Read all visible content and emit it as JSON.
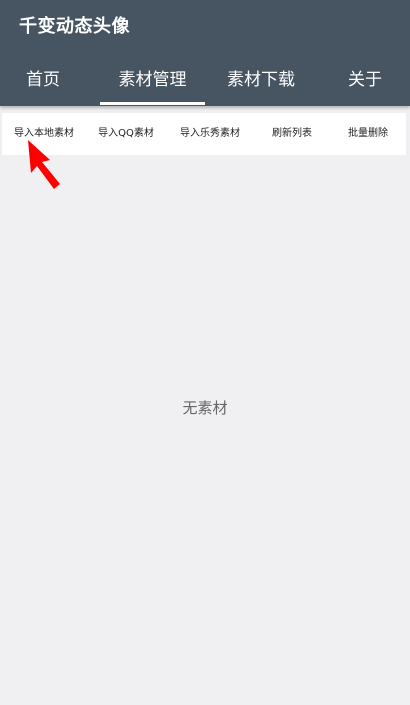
{
  "app": {
    "title": "千变动态头像"
  },
  "tabs": [
    {
      "label": "首页",
      "selected": false
    },
    {
      "label": "素材管理",
      "selected": true
    },
    {
      "label": "素材下载",
      "selected": false
    },
    {
      "label": "关于",
      "selected": false
    }
  ],
  "toolbar": {
    "buttons": [
      {
        "label": "导入本地素材"
      },
      {
        "label": "导入QQ素材"
      },
      {
        "label": "导入乐秀素材"
      },
      {
        "label": "刷新列表"
      },
      {
        "label": "批量删除"
      }
    ]
  },
  "content": {
    "empty_text": "无素材"
  },
  "colors": {
    "header_bg": "#475563",
    "body_bg": "#f0eff2",
    "annotation_arrow": "#ff0000"
  },
  "icons": {
    "annotation": "red-arrow-icon"
  }
}
